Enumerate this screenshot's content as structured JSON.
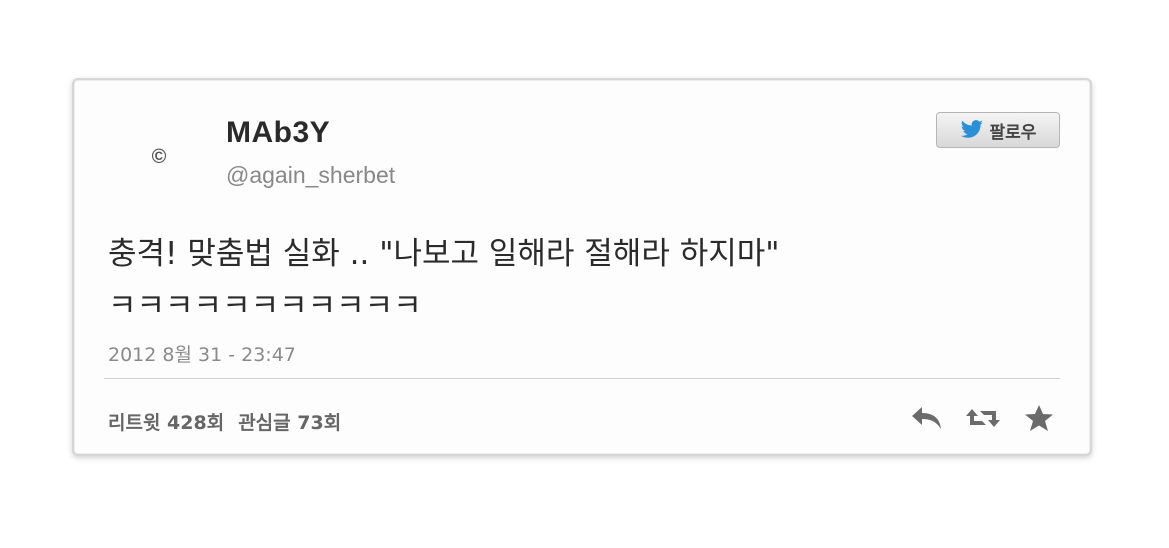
{
  "tweet": {
    "display_name": "MAb3Y",
    "handle": "@again_sherbet",
    "follow_label": "팔로우",
    "text": "충격! 맞춤법 실화 .. \"나보고 일해라 절해라 하지마\" ㅋㅋㅋㅋㅋㅋㅋㅋㅋㅋㅋ",
    "timestamp": "2012 8월 31 - 23:47",
    "retweet_stat": "리트윗 428회",
    "favorite_stat": "관심글 73회"
  },
  "icons": {
    "avatar": "avatar-icon",
    "follow": "twitter-bird-icon",
    "reply": "reply-icon",
    "retweet": "retweet-icon",
    "favorite": "star-icon"
  },
  "colors": {
    "card_border": "#d6d6d6",
    "twitter_blue": "#2a8fd6",
    "icon_gray": "#6b6b6b"
  }
}
